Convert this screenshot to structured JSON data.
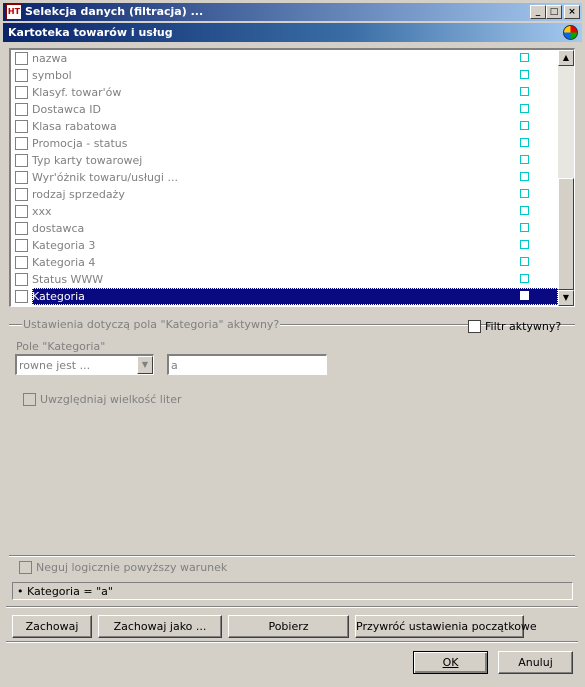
{
  "window": {
    "title": "Selekcja danych (filtracja) ...",
    "app_icon_text": "HT",
    "minimize_glyph": "_",
    "maximize_glyph": "□",
    "close_glyph": "×"
  },
  "header": {
    "title": "Kartoteka towarów i usług"
  },
  "fields": [
    {
      "label": "nazwa",
      "checked": false
    },
    {
      "label": "symbol",
      "checked": false
    },
    {
      "label": "Klasyf. towar'ów",
      "checked": false
    },
    {
      "label": "Dostawca ID",
      "checked": false
    },
    {
      "label": "Klasa rabatowa",
      "checked": false
    },
    {
      "label": "Promocja - status",
      "checked": false
    },
    {
      "label": "Typ karty towarowej",
      "checked": false
    },
    {
      "label": "Wyr'óżnik towaru/usługi ...",
      "checked": false
    },
    {
      "label": "rodzaj sprzedaży",
      "checked": false
    },
    {
      "label": "xxx",
      "checked": false
    },
    {
      "label": "dostawca",
      "checked": false
    },
    {
      "label": "Kategoria 3",
      "checked": false
    },
    {
      "label": "Kategoria 4",
      "checked": false
    },
    {
      "label": "Status WWW",
      "checked": false
    },
    {
      "label": "Kategoria",
      "checked": false,
      "selected": true
    }
  ],
  "settings": {
    "group_title": "Ustawienia dotyczą pola \"Kategoria\" aktywny?",
    "filter_active_label": "Filtr aktywny?",
    "filter_active": false,
    "field_label": "Pole \"Kategoria\"",
    "operator_value": "rowne jest ...",
    "value": "a",
    "case_sensitive_label": "Uwzględniaj wielkość liter",
    "negate_label": "Neguj logicznie powyższy warunek"
  },
  "summary": {
    "text": "• Kategoria = \"a\""
  },
  "buttons": {
    "save": "Zachowaj",
    "save_as": "Zachowaj jako ...",
    "load": "Pobierz",
    "restore": "Przywróć ustawienia początkowe",
    "ok": "OK",
    "cancel": "Anuluj"
  },
  "scrollbar": {
    "up_glyph": "▲",
    "down_glyph": "▼"
  }
}
